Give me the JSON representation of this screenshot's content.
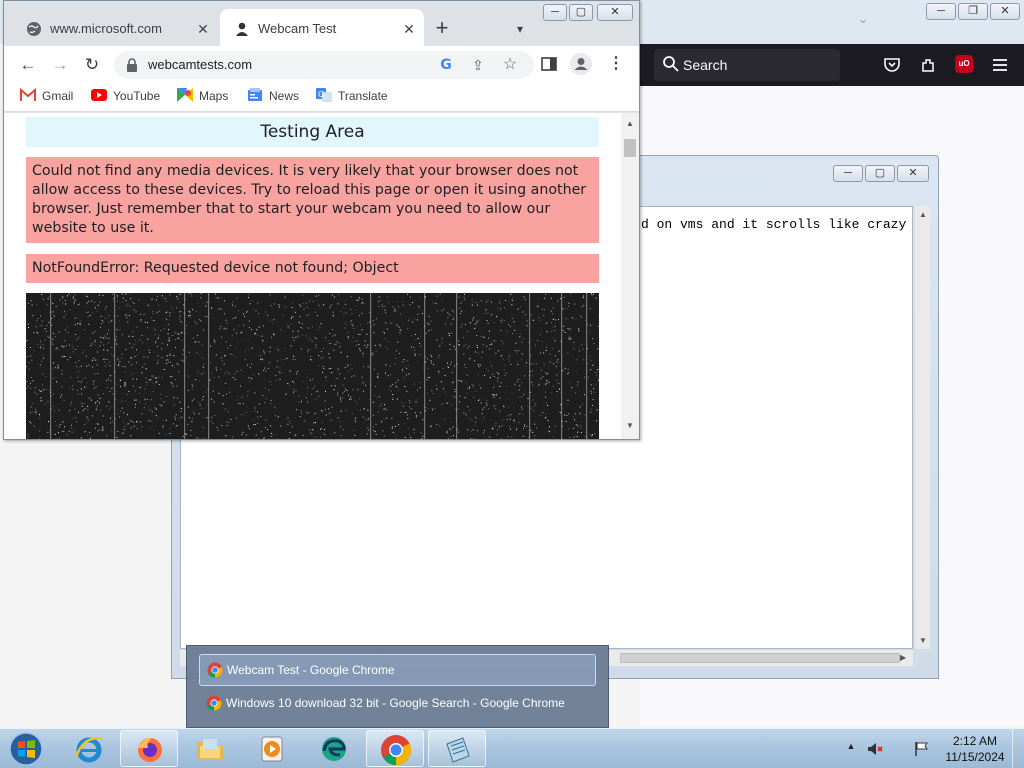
{
  "firefox": {
    "search_placeholder": "Search",
    "window_controls": [
      "─",
      "❐",
      "✕"
    ]
  },
  "editor": {
    "visible_text": "d on vms and it scrolls like crazy",
    "window_controls": [
      "─",
      "▢",
      "✕"
    ]
  },
  "chrome": {
    "window_controls": [
      "─",
      "▢",
      "✕"
    ],
    "tabs": [
      {
        "title": "www.microsoft.com",
        "icon": "globe-icon",
        "active": false
      },
      {
        "title": "Webcam Test",
        "icon": "webcam-person-icon",
        "active": true
      }
    ],
    "new_tab_label": "+",
    "url": "webcamtests.com",
    "bookmarks": [
      {
        "label": "Gmail",
        "icon": "gmail-icon"
      },
      {
        "label": "YouTube",
        "icon": "youtube-icon"
      },
      {
        "label": "Maps",
        "icon": "maps-icon"
      },
      {
        "label": "News",
        "icon": "news-icon"
      },
      {
        "label": "Translate",
        "icon": "translate-icon"
      }
    ]
  },
  "page": {
    "testing_area": "Testing Area",
    "error_message": "Could not find any media devices. It is very likely that your browser does not allow access to these devices. Try to reload this page or open it using another browser. Just remember that to start your webcam you need to allow our website to use it.",
    "not_found_error": "NotFoundError: Requested device not found; Object"
  },
  "taskbar": {
    "thumbnails": [
      {
        "title": "Webcam Test - Google Chrome",
        "selected": true
      },
      {
        "title": "Windows 10 download 32 bit - Google Search - Google Chrome",
        "selected": false
      }
    ],
    "pinned": [
      "ie-icon",
      "firefox-icon",
      "explorer-icon",
      "media-player-icon",
      "edge-icon",
      "chrome-icon",
      "notepad-icon"
    ],
    "clock_time": "2:12 AM",
    "clock_date": "11/15/2024"
  },
  "colors": {
    "error_bg": "#f9a3a1",
    "testing_bg": "#e2f6fd",
    "firefox_toolbar": "#1c1b22"
  }
}
